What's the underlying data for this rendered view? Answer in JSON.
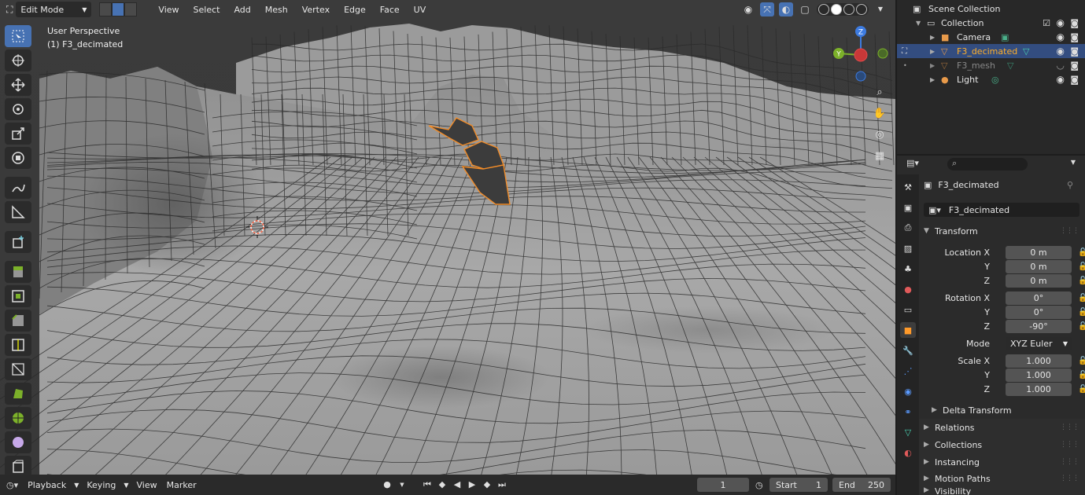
{
  "viewport": {
    "mode": "Edit Mode",
    "menu": [
      "View",
      "Select",
      "Add",
      "Mesh",
      "Vertex",
      "Edge",
      "Face",
      "UV"
    ],
    "perspective": "User Perspective",
    "object": "(1) F3_decimated",
    "gizmo_axes": {
      "z": "Z",
      "y": "Y"
    },
    "toolbar_tools": [
      "select-box",
      "cursor",
      "move",
      "rotate",
      "scale",
      "transform",
      "annotate",
      "measure",
      "add-cube",
      "extrude",
      "inset",
      "bevel",
      "loop-cut",
      "knife",
      "poly-build",
      "spin",
      "smooth",
      "shrink-fatten"
    ]
  },
  "timeline": {
    "menus": [
      "Playback",
      "Keying",
      "View",
      "Marker"
    ],
    "current_frame": "1",
    "start_label": "Start",
    "start_value": "1",
    "end_label": "End",
    "end_value": "250"
  },
  "outliner": {
    "root": "Scene Collection",
    "collection": "Collection",
    "items": [
      {
        "label": "Camera",
        "state": "normal"
      },
      {
        "label": "F3_decimated",
        "state": "selected"
      },
      {
        "label": "F3_mesh",
        "state": "hidden"
      },
      {
        "label": "Light",
        "state": "normal"
      }
    ]
  },
  "properties": {
    "object_name": "F3_decimated",
    "datablock_name": "F3_decimated",
    "transform_header": "Transform",
    "location": {
      "label": "Location X",
      "x": "0 m",
      "y": "0 m",
      "z": "0 m"
    },
    "rotation": {
      "label": "Rotation X",
      "x": "0°",
      "y": "0°",
      "z": "-90°"
    },
    "mode_label": "Mode",
    "mode_value": "XYZ Euler",
    "scale": {
      "label": "Scale X",
      "x": "1.000",
      "y": "1.000",
      "z": "1.000"
    },
    "axis_y": "Y",
    "axis_z": "Z",
    "delta": "Delta Transform",
    "panels": [
      "Relations",
      "Collections",
      "Instancing",
      "Motion Paths",
      "Visibility"
    ]
  },
  "colors": {
    "accent": "#4772b3",
    "selected_text": "#ffaf29",
    "x_axis": "#e04a4a",
    "y_axis": "#7cb12a",
    "z_axis": "#3d7be0"
  }
}
